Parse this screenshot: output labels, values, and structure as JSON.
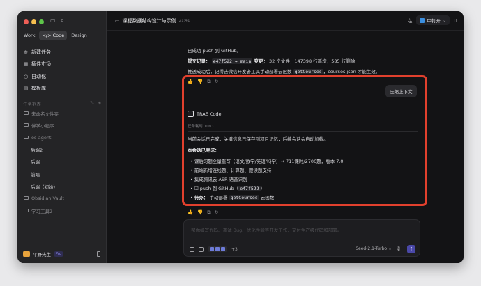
{
  "sidebar": {
    "modes": [
      "Work",
      "</> Code",
      "Design"
    ],
    "nav": [
      {
        "label": "新建任务",
        "icon": "plus-circle-icon"
      },
      {
        "label": "插件市场",
        "icon": "grid-icon"
      },
      {
        "label": "自动化",
        "icon": "clock-icon"
      },
      {
        "label": "模板库",
        "icon": "template-icon"
      }
    ],
    "tasks_header": "任务列表",
    "tree": [
      {
        "label": "未命名文件夹",
        "sub": false
      },
      {
        "label": "伴学小程序",
        "sub": false
      },
      {
        "label": "os-agent",
        "sub": false
      },
      {
        "label": "后端2",
        "sub": true
      },
      {
        "label": "后端",
        "sub": true
      },
      {
        "label": "前端",
        "sub": true
      },
      {
        "label": "后端（初始）",
        "sub": true
      },
      {
        "label": "Obsidian Vault",
        "sub": false
      },
      {
        "label": "学习工具2",
        "sub": false
      }
    ],
    "user": {
      "name": "平野先生",
      "badge": "Pro"
    }
  },
  "topbar": {
    "title": "课程数据结构设计与示例",
    "time": "21:41",
    "lang": "在",
    "open_label": "中打开"
  },
  "messages": {
    "pushed": "已成功 push 到 GitHub。",
    "commit_label": "提交记录：",
    "commit_code": "e47f522 → main",
    "commit_changes_label": "变更：",
    "commit_changes": "32 个文件，147398 行新增，585 行删除",
    "deploy_prefix": "推送成功后，记得去微信开发者工具手动部署云函数",
    "deploy_code": "getCourses",
    "deploy_suffix": "，courses.json 才能生效。"
  },
  "user_bubble": "压缩上下文",
  "assistant": {
    "name": "TRAE Code",
    "elapsed": "任务耗时 10s ›",
    "intro": "当前会话已完成，关键信息已保存到项目记忆，后续会话会自动加载。",
    "done_header": "本会话已完成：",
    "bullets": [
      "课后习题全量重写（语文/数学/英语/科学）→ 711课时/2706题，版本 7.0",
      "前端新增连线题、计算题、跟读题支持",
      "集成腾讯云 ASR 语音识别"
    ],
    "push_text": "☑ push 到 GitHub（",
    "push_code": "e47f522",
    "push_end": "）",
    "todo_label": "待办：",
    "todo_text": "手动部署",
    "todo_code": "getCourses",
    "todo_end": "云函数"
  },
  "input": {
    "placeholder": "帮你编写代码、调试 Bug、优化性能等开发工作，交付生产级代码和部署。",
    "attach_more": "+3",
    "model": "Seed-2.1-Turbo ⌄"
  }
}
